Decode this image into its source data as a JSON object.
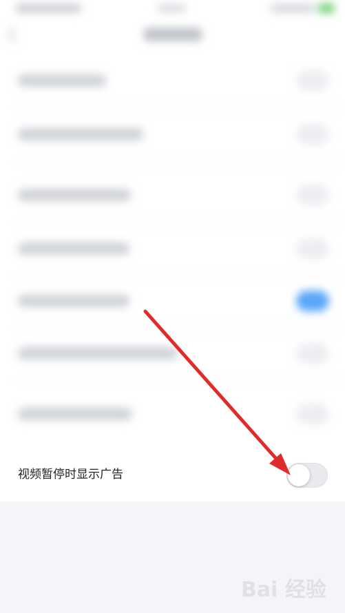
{
  "settings": {
    "ad_on_pause": {
      "label": "视频暂停时显示广告",
      "enabled": false
    }
  },
  "colors": {
    "accent_toggle_on": "#5aa6f8",
    "annotation_arrow": "#e02b2b"
  },
  "icons": {
    "back": "back-icon",
    "watermark": "baidu-jingyan-logo"
  },
  "watermark": {
    "text": "Bai 经验"
  }
}
